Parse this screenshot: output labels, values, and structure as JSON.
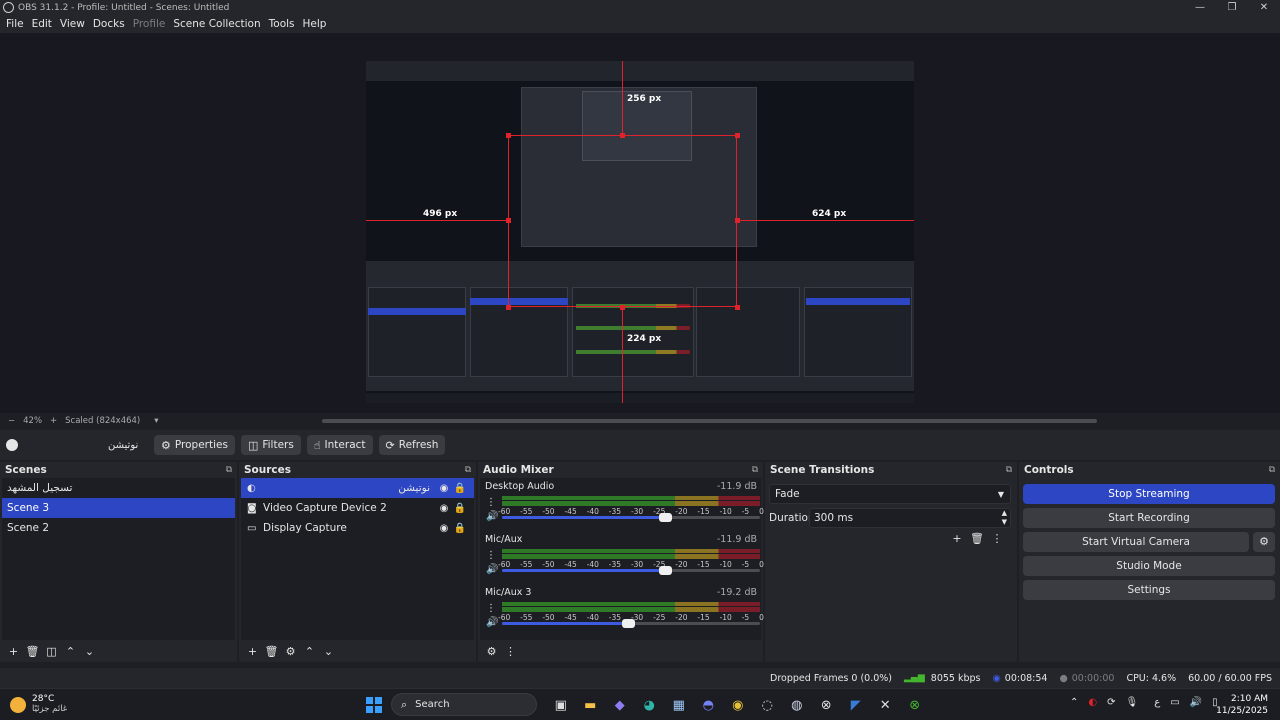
{
  "window": {
    "title": "OBS 31.1.2 - Profile: Untitled - Scenes: Untitled",
    "controls": [
      "—",
      "❐",
      "✕"
    ]
  },
  "menu": {
    "items": [
      "File",
      "Edit",
      "View",
      "Docks",
      "Profile",
      "Scene Collection",
      "Tools",
      "Help"
    ]
  },
  "preview": {
    "measure_top": "256 px",
    "measure_left": "496 px",
    "measure_right": "624 px",
    "measure_bottom": "224 px"
  },
  "preview_status": {
    "zoom_minus": "−",
    "zoom": "42%",
    "zoom_plus": "+",
    "scale_mode": "Scaled (824x464)",
    "dropdown": "▾"
  },
  "source_toolbar": {
    "source_name": "نوتيشن",
    "properties": "Properties",
    "filters": "Filters",
    "interact": "Interact",
    "refresh": "Refresh"
  },
  "scenes": {
    "title": "Scenes",
    "items": [
      "تسجيل المشهد",
      "Scene 3",
      "Scene 2"
    ],
    "selected_index": 1
  },
  "sources": {
    "title": "Sources",
    "items": [
      {
        "name": "نوتيشن",
        "icon": "browser-icon",
        "selected": true
      },
      {
        "name": "Video Capture Device 2",
        "icon": "camera-icon",
        "selected": false
      },
      {
        "name": "Display Capture",
        "icon": "monitor-icon",
        "selected": false
      }
    ]
  },
  "audio_mixer": {
    "title": "Audio Mixer",
    "ticks": [
      "-60",
      "-55",
      "-50",
      "-45",
      "-40",
      "-35",
      "-30",
      "-25",
      "-20",
      "-15",
      "-10",
      "-5",
      "0"
    ],
    "channels": [
      {
        "name": "Desktop Audio",
        "db": "-11.9 dB",
        "volume": 0.63
      },
      {
        "name": "Mic/Aux",
        "db": "-11.9 dB",
        "volume": 0.63
      },
      {
        "name": "Mic/Aux 3",
        "db": "-19.2 dB",
        "volume": 0.49
      }
    ]
  },
  "scene_transitions": {
    "title": "Scene Transitions",
    "transition": "Fade",
    "duration_label": "Duration",
    "duration_value": "300 ms"
  },
  "controls": {
    "title": "Controls",
    "stop_streaming": "Stop Streaming",
    "start_recording": "Start Recording",
    "start_virtual_camera": "Start Virtual Camera",
    "studio_mode": "Studio Mode",
    "settings": "Settings"
  },
  "statusbar": {
    "dropped_frames": "Dropped Frames 0 (0.0%)",
    "bitrate": "8055 kbps",
    "stream_time": "00:08:54",
    "record_time": "00:00:00",
    "cpu": "CPU: 4.6%",
    "fps": "60.00 / 60.00 FPS"
  },
  "taskbar": {
    "temperature": "28°C",
    "weather_condition": "غائم جزئيًا",
    "search_placeholder": "Search",
    "language": "ع",
    "time": "2:10 AM",
    "date": "11/25/2025"
  },
  "colors": {
    "accent": "#2c46c4",
    "meter_green": "#2e7a27",
    "meter_yellow": "#8a7422",
    "meter_red": "#7a1d28",
    "measure_red": "#e0222b"
  }
}
